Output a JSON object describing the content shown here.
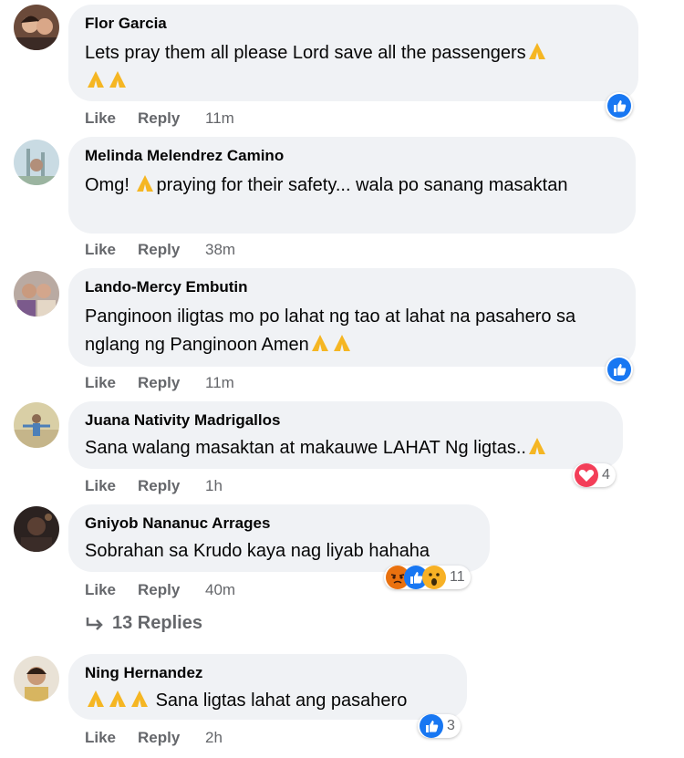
{
  "colors": {
    "like_blue": "#1877f2",
    "love_red": "#f33e58",
    "angry_orange": "#e9710f",
    "bubble_bg": "#f0f2f5",
    "meta_gray": "#65676b"
  },
  "actions": {
    "like_label": "Like",
    "reply_label": "Reply"
  },
  "comments": [
    {
      "author": "Flor Garcia",
      "text": "Lets pray them all please Lord save all the passengers",
      "time": "11m",
      "reactions": [
        "like-icon"
      ],
      "reaction_count": ""
    },
    {
      "author": "Melinda Melendrez Camino",
      "text_a": "Omg!",
      "text_b": "praying for their safety... wala po sanang masaktan",
      "time": "38m",
      "reactions": [],
      "reaction_count": ""
    },
    {
      "author": "Lando-Mercy Embutin",
      "text": "Panginoon iligtas mo po lahat ng tao at lahat na pasahero sa nglang ng Panginoon Amen",
      "time": "11m",
      "reactions": [
        "like-icon"
      ],
      "reaction_count": ""
    },
    {
      "author": "Juana Nativity Madrigallos",
      "text": "Sana walang masaktan at makauwe LAHAT Ng ligtas..",
      "time": "1h",
      "reactions": [
        "love-icon"
      ],
      "reaction_count": "4"
    },
    {
      "author": "Gniyob Nananuc Arrages",
      "text": "Sobrahan sa Krudo kaya nag liyab hahaha",
      "time": "40m",
      "reactions": [
        "angry-icon",
        "like-icon",
        "wow-icon"
      ],
      "reaction_count": "11"
    },
    {
      "author": "Ning Hernandez",
      "text": "Sana ligtas lahat ang pasahero",
      "time": "2h",
      "reactions": [
        "like-icon"
      ],
      "reaction_count": "3"
    }
  ],
  "replies_link": {
    "label": "13 Replies",
    "icon": "reply-arrow-icon"
  }
}
